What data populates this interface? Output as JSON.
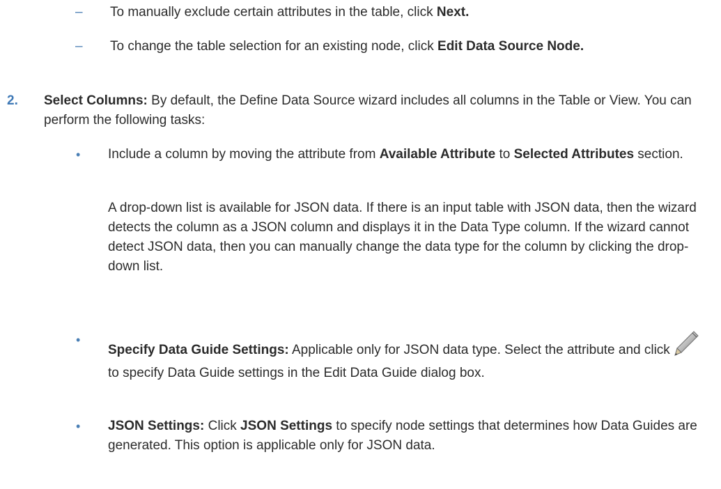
{
  "dash_items": [
    {
      "mark": "–",
      "text_before": "To manually exclude certain attributes in the table, click ",
      "bold": "Next.",
      "text_after": ""
    },
    {
      "mark": "–",
      "text_before": "To change the table selection for an existing node, click ",
      "bold": "Edit Data Source Node.",
      "text_after": ""
    }
  ],
  "step2": {
    "number": "2.",
    "bold": "Select Columns:",
    "text": " By default, the Define Data Source wizard includes all columns in the Table or View. You can perform the following tasks:"
  },
  "bullets": [
    {
      "mark": "•",
      "text_before": "Include a column by moving the attribute from ",
      "bold1": "Available Attribute",
      "text_mid": " to ",
      "bold2": "Selected Attributes",
      "text_after": " section."
    },
    {
      "mark": "•",
      "bold": "Specify Data Guide Settings:",
      "text_before_icon": " Applicable only for JSON data type. Select the attribute and click",
      "icon": "pencil-icon",
      "text_after_icon": "to specify Data Guide settings in the Edit Data Guide dialog box."
    },
    {
      "mark": "•",
      "bold1": "JSON Settings:",
      "text_before": " Click ",
      "bold2": "JSON Settings",
      "text_after": " to specify node settings that determines how Data Guides are generated. This option is applicable only for JSON data."
    }
  ],
  "json_paragraph": "A drop-down list is available for JSON data. If there is an input table with JSON data, then the wizard detects the column as a JSON column and displays it in the Data Type column. If the wizard cannot detect JSON data, then you can manually change the data type for the column by clicking the drop-down list."
}
